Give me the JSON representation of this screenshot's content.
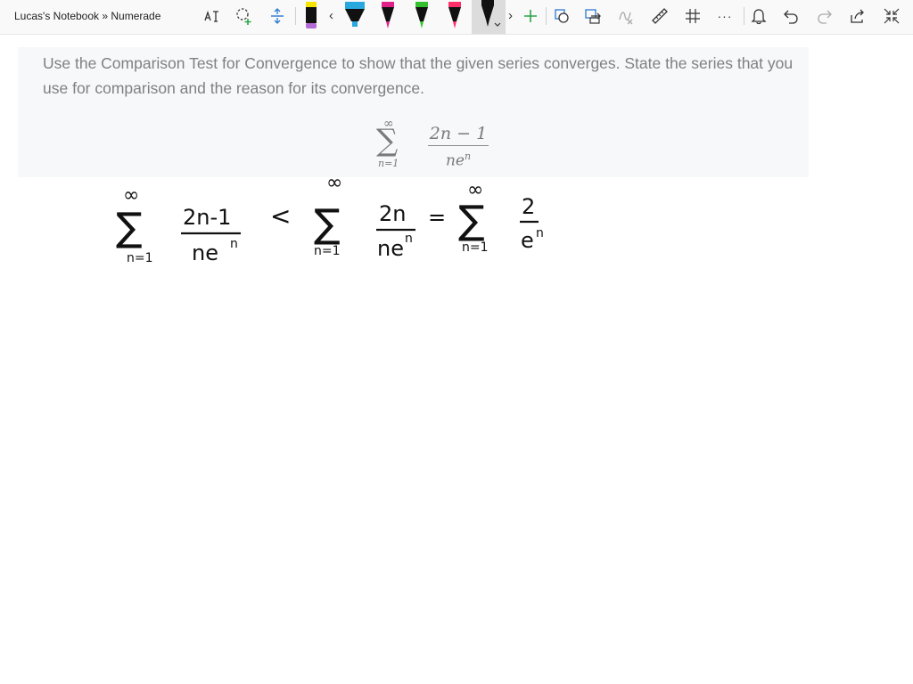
{
  "app": {
    "title": "Lucas's Notebook » Numerade"
  },
  "toolbar": {
    "icons": [
      "text-select-icon",
      "lasso-add-icon",
      "add-space-icon",
      "pen-icon",
      "chevron-left-icon",
      "highlighter-icon",
      "pen-icon",
      "pen-icon",
      "pen-icon",
      "pen-icon",
      "chevron-right-icon",
      "add-pen-icon",
      "shape-icon",
      "convert-icon",
      "math-icon",
      "ruler-icon",
      "snap-icon",
      "more-icon",
      "bell-icon",
      "undo-icon",
      "redo-icon",
      "share-icon",
      "collapse-icon"
    ],
    "chevron_left": "‹",
    "chevron_right": "›",
    "add_label": "+",
    "more_label": "···",
    "colors": {
      "pen_black_yellow": "#111111",
      "pen_yellow_tip": "#f4e400",
      "highlighter": "#29a8e0",
      "pen_magenta": "#e0218a",
      "pen_green": "#35c12f",
      "pen_pink": "#ff2f6a",
      "pen_black": "#111111",
      "accent_green": "#2aa648",
      "accent_blue": "#2b78d0"
    }
  },
  "question": {
    "text": "Use the Comparison Test for Convergence to show that the given series converges. State the series that you use for comparison and the reason for its convergence.",
    "formula": {
      "sigma": "∑",
      "upper": "∞",
      "lower": "n=1",
      "numerator": "2n − 1",
      "denominator_base": "ne",
      "denominator_exp": "n"
    }
  },
  "handwriting": {
    "ink_color": "#111111",
    "sum1": {
      "upper": "∞",
      "sigma": "∑",
      "lower": "n=1",
      "numerator": "2n-1",
      "denominator": "ne",
      "exp": "n"
    },
    "relation1": "<",
    "sum2": {
      "upper": "∞",
      "sigma": "∑",
      "lower": "n=1",
      "numerator": "2n",
      "denominator": "ne",
      "exp": "n"
    },
    "relation2": "=",
    "sum3": {
      "upper": "∞",
      "sigma": "∑",
      "lower": "n=1",
      "numerator": "2",
      "denominator": "e",
      "exp": "n"
    }
  }
}
